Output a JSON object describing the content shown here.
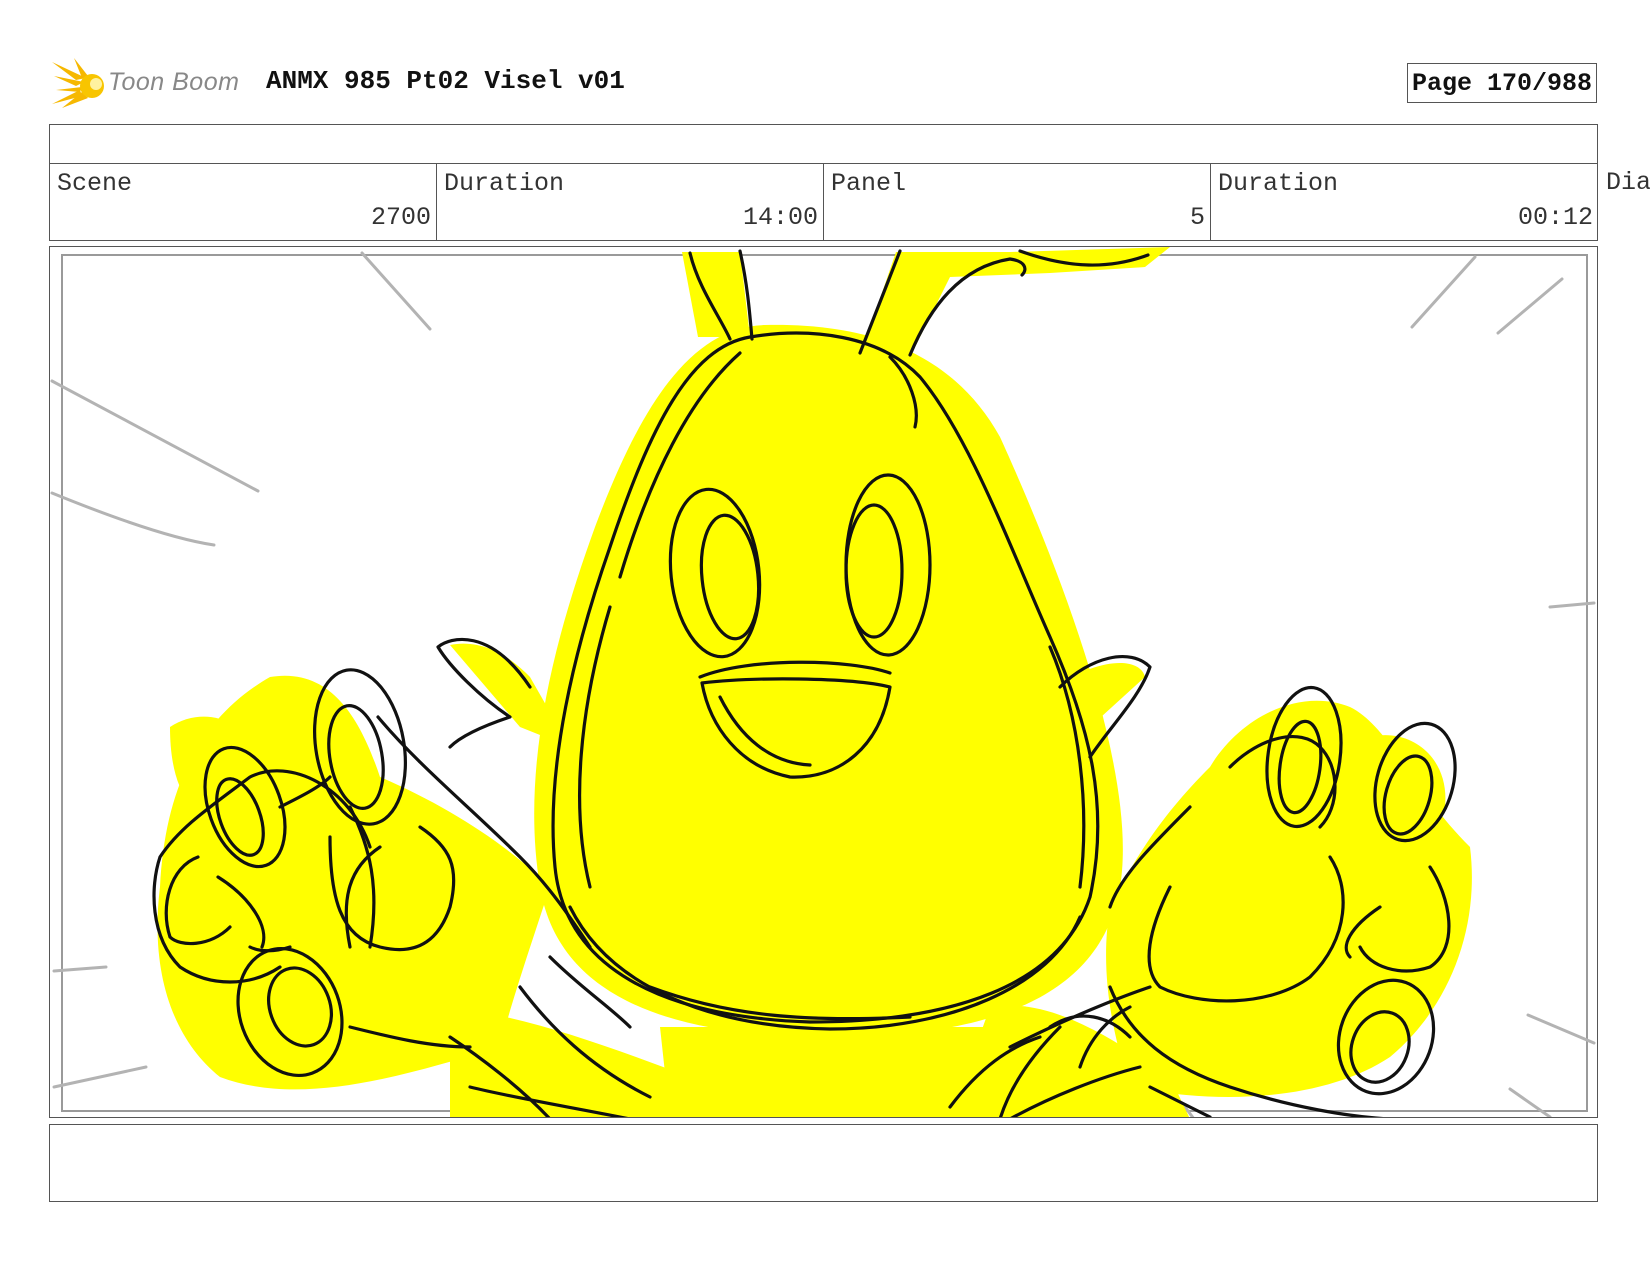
{
  "header": {
    "logo_text": "Toon Boom",
    "logo_icon": "toon-boom-star-icon",
    "title": "ANMX 985 Pt02 Visel v01",
    "page": "Page 170/988"
  },
  "table": {
    "scene_label": "Scene",
    "scene_value": "2700",
    "scene_duration_label": "Duration",
    "scene_duration_value": "14:00",
    "panel_label": "Panel",
    "panel_value": "5",
    "panel_duration_label": "Duration",
    "panel_duration_value": "00:12",
    "overflow_label": "Dia"
  },
  "colors": {
    "character_fill": "#ffff00",
    "line": "#111111",
    "logo_accent": "#f6b800"
  }
}
